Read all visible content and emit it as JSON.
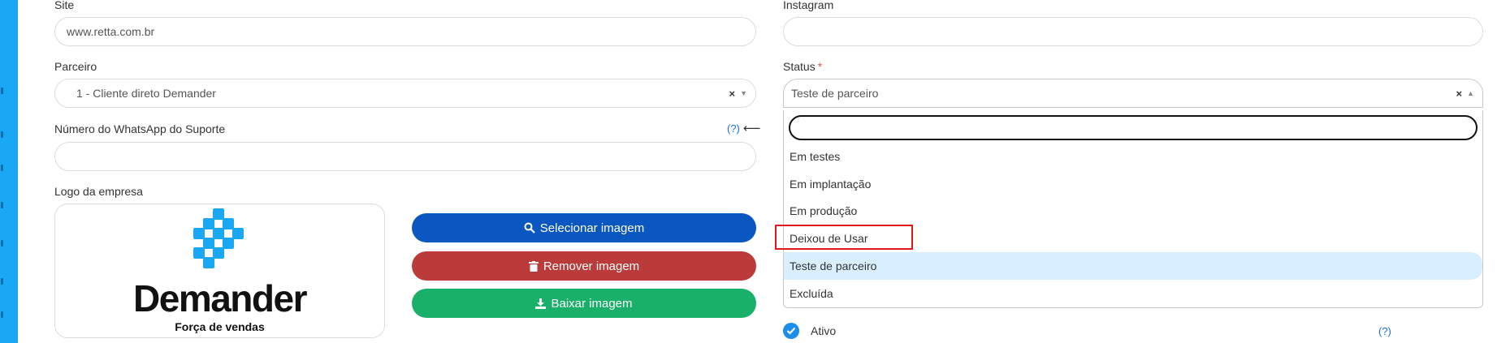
{
  "form": {
    "site": {
      "label": "Site",
      "value": "www.retta.com.br"
    },
    "instagram": {
      "label": "Instagram",
      "value": ""
    },
    "parceiro": {
      "label": "Parceiro",
      "value": "1 - Cliente direto Demander",
      "clear": "×",
      "caret": "▼"
    },
    "status": {
      "label": "Status",
      "required_mark": "*",
      "value": "Teste de parceiro",
      "clear": "×",
      "caret": "▲"
    },
    "whatsapp": {
      "label": "Número do WhatsApp do Suporte",
      "help": "(?)",
      "arrow": "⟵",
      "value": ""
    },
    "logo": {
      "label": "Logo da empresa",
      "brand_name": "Demander",
      "brand_tagline": "Força de vendas"
    }
  },
  "buttons": {
    "select_image": "Selecionar imagem",
    "remove_image": "Remover imagem",
    "download_image": "Baixar imagem"
  },
  "status_dropdown": {
    "search_value": "",
    "options": [
      "Em testes",
      "Em implantação",
      "Em produção",
      "Deixou de Usar",
      "Teste de parceiro",
      "Excluída"
    ],
    "selected": "Teste de parceiro",
    "highlighted_option": "Deixou de Usar"
  },
  "ativo": {
    "label": "Ativo",
    "checked": true,
    "help": "(?)"
  },
  "colors": {
    "accent": "#1aa8f5",
    "btn_select": "#0a57c2",
    "btn_remove": "#bb3a3a",
    "btn_download": "#19b06a",
    "highlight": "#e2171c",
    "selected_option_bg": "#d9efff"
  },
  "icons": {
    "select": "search-icon",
    "remove": "trash-icon",
    "download": "download-icon",
    "check": "check-icon"
  }
}
